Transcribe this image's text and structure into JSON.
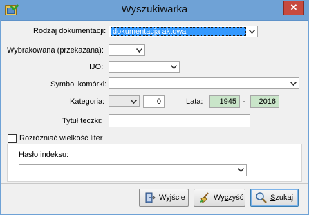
{
  "window": {
    "title": "Wyszukiwarka",
    "close_glyph": "✕"
  },
  "form": {
    "rodzaj": {
      "label": "Rodzaj dokumentacji:",
      "value": "dokumentacja aktowa"
    },
    "wybrakowana": {
      "label": "Wybrakowana (przekazana):",
      "value": ""
    },
    "ijo": {
      "label": "IJO:",
      "value": ""
    },
    "symbol": {
      "label": "Symbol komórki:",
      "value": ""
    },
    "kategoria": {
      "label": "Kategoria:",
      "value": "",
      "number": "0"
    },
    "lata": {
      "label": "Lata:",
      "from": "1945",
      "separator": "-",
      "to": "2016"
    },
    "tytul": {
      "label": "Tytuł teczki:",
      "value": ""
    },
    "case_sensitive": {
      "label": "Rozróżniać wielkość liter",
      "checked": false
    },
    "haslo": {
      "label": "Hasło indeksu:",
      "value": ""
    }
  },
  "buttons": {
    "exit": {
      "label_pre": "Wy",
      "label_ul": "j",
      "label_post": "ście"
    },
    "clear": {
      "label_pre": "Wy",
      "label_ul": "c",
      "label_post": "zyść"
    },
    "search": {
      "label_pre": "",
      "label_ul": "S",
      "label_post": "zukaj"
    }
  },
  "icons": {
    "app": "search-window-icon",
    "exit": "exit-door-icon",
    "clear": "broom-icon",
    "search": "magnifier-icon"
  },
  "colors": {
    "titlebar": "#6fa2d6",
    "close": "#c74a3f",
    "selection": "#3399ff",
    "year_fields": "#c9e5c9"
  }
}
